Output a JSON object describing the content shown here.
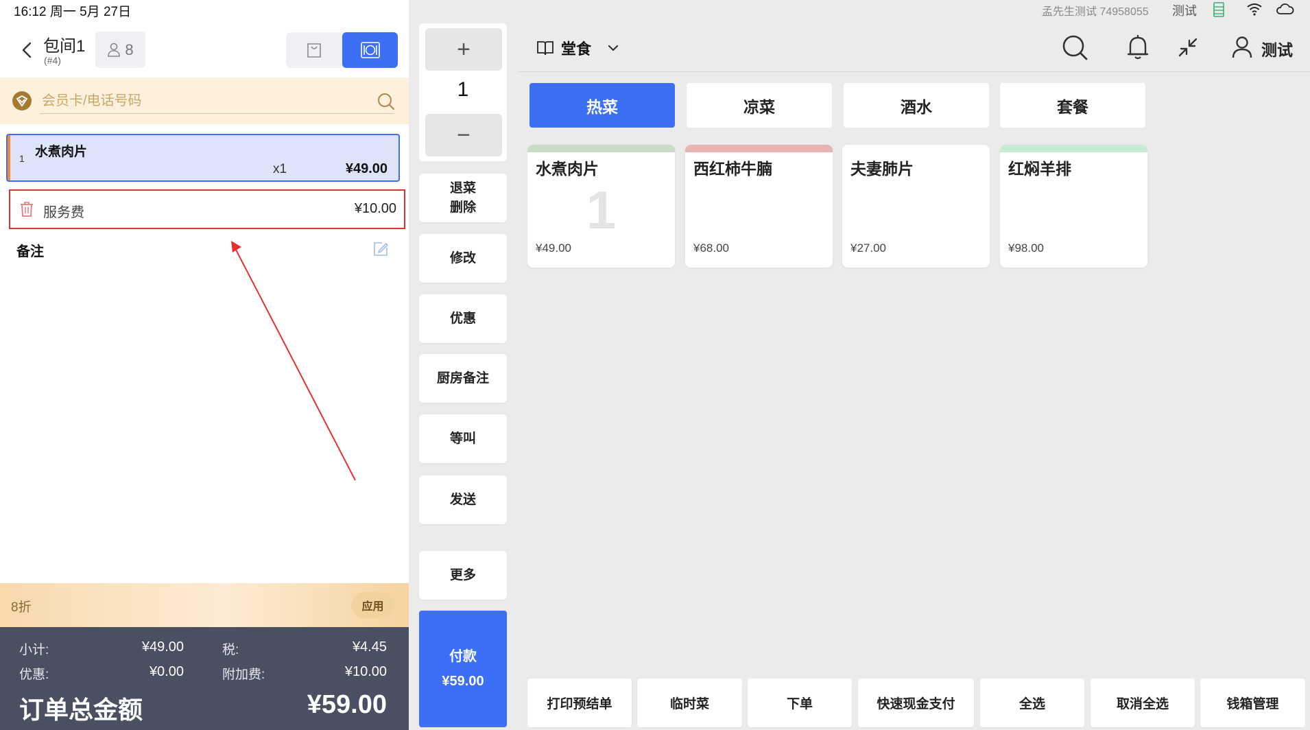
{
  "status_bar": {
    "datetime": "16:12 周一 5月 27日",
    "account": "孟先生测试 74958055",
    "user": "测试"
  },
  "order_header": {
    "table_name": "包间1",
    "order_no": "(#4)",
    "guests": "8",
    "modes": [
      {
        "icon": "shopping-bag-icon",
        "selected": false
      },
      {
        "icon": "dine-in-plate-icon",
        "selected": true
      }
    ]
  },
  "member_search": {
    "placeholder": "会员卡/电话号码",
    "value": ""
  },
  "order_items": [
    {
      "index": "1",
      "name": "水煮肉片",
      "qty": "x1",
      "price": "¥49.00",
      "selected": true
    }
  ],
  "service_fee": {
    "label": "服务费",
    "amount": "¥10.00"
  },
  "note": {
    "label": "备注"
  },
  "discount": {
    "label": "8折",
    "apply_label": "应用"
  },
  "totals": {
    "subtotal_label": "小计:",
    "subtotal": "¥49.00",
    "tax_label": "税:",
    "tax": "¥4.45",
    "discount_label": "优惠:",
    "discount": "¥0.00",
    "surcharge_label": "附加费:",
    "surcharge": "¥10.00",
    "total_label": "订单总金额",
    "total": "¥59.00"
  },
  "quantity": {
    "value": "1",
    "plus": "+",
    "minus": "−"
  },
  "actions": {
    "void_line1": "退菜",
    "void_line2": "删除",
    "modify": "修改",
    "promotion": "优惠",
    "kitchen_note": "厨房备注",
    "hold": "等叫",
    "send": "发送",
    "more": "更多"
  },
  "pay": {
    "label": "付款",
    "amount": "¥59.00"
  },
  "dining_mode": {
    "label": "堂食"
  },
  "header_user": {
    "label": "测试"
  },
  "categories": [
    {
      "label": "热菜",
      "active": true
    },
    {
      "label": "凉菜",
      "active": false
    },
    {
      "label": "酒水",
      "active": false
    },
    {
      "label": "套餐",
      "active": false
    }
  ],
  "menu_items": [
    {
      "name": "水煮肉片",
      "price": "¥49.00",
      "qty_badge": "1",
      "stripe": "#c8dcc6"
    },
    {
      "name": "西红柿牛腩",
      "price": "¥68.00",
      "qty_badge": "",
      "stripe": "#eab4b2"
    },
    {
      "name": "夫妻肺片",
      "price": "¥27.00",
      "qty_badge": "",
      "stripe": "#ffffff"
    },
    {
      "name": "红焖羊排",
      "price": "¥98.00",
      "qty_badge": "",
      "stripe": "#c6ecd6"
    }
  ],
  "bottom_actions": [
    {
      "label": "打印预结单"
    },
    {
      "label": "临时菜"
    },
    {
      "label": "下单"
    },
    {
      "label": "快速现金支付"
    },
    {
      "label": "全选"
    },
    {
      "label": "取消全选"
    },
    {
      "label": "钱箱管理"
    }
  ],
  "colors": {
    "accent": "#3d6ff4",
    "annotation": "#e5302e",
    "totals_bg": "#4a5062",
    "member_bg": "#fdf1dd"
  }
}
